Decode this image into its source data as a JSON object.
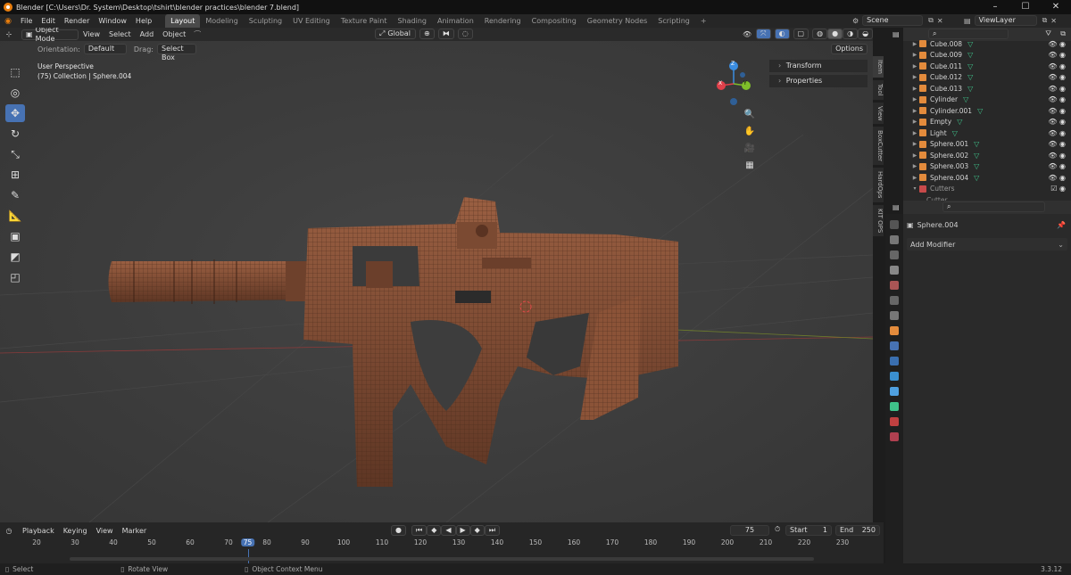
{
  "window": {
    "title": "Blender [C:\\Users\\Dr. System\\Desktop\\tshirt\\blender practices\\blender 7.blend]"
  },
  "menu": {
    "items": [
      "File",
      "Edit",
      "Render",
      "Window",
      "Help"
    ],
    "workspaces": [
      "Layout",
      "Modeling",
      "Sculpting",
      "UV Editing",
      "Texture Paint",
      "Shading",
      "Animation",
      "Rendering",
      "Compositing",
      "Geometry Nodes",
      "Scripting"
    ],
    "active_workspace": "Layout",
    "add_tab": "+",
    "scene": "Scene",
    "view_layer": "ViewLayer"
  },
  "viewport": {
    "mode": "Object Mode",
    "header_menus": [
      "View",
      "Select",
      "Add",
      "Object"
    ],
    "transform_orientation": "Global",
    "orientation_label": "Orientation:",
    "orientation_value": "Default",
    "drag_label": "Drag:",
    "drag_value": "Select Box",
    "options_label": "Options",
    "perspective": "User Perspective",
    "collection_info": "(75) Collection | Sphere.004",
    "npanel": [
      "Transform",
      "Properties"
    ],
    "sidebar_tabs": [
      "Item",
      "Tool",
      "View",
      "BoxCutter",
      "HardOps",
      "KIT OPS"
    ],
    "gizmo": {
      "x": "X",
      "y": "Y",
      "z": "Z"
    }
  },
  "outliner": {
    "items": [
      {
        "name": "Cube.008",
        "mods": 2
      },
      {
        "name": "Cube.009",
        "mods": 1
      },
      {
        "name": "Cube.011",
        "mods": 2
      },
      {
        "name": "Cube.012",
        "mods": 2
      },
      {
        "name": "Cube.013",
        "mods": 1
      },
      {
        "name": "Cylinder",
        "mods": 2
      },
      {
        "name": "Cylinder.001",
        "mods": 2
      },
      {
        "name": "Empty",
        "mods": 1
      },
      {
        "name": "Light",
        "mods": 1
      },
      {
        "name": "Sphere.001",
        "mods": 2
      },
      {
        "name": "Sphere.002",
        "mods": 1
      },
      {
        "name": "Sphere.003",
        "mods": 1
      },
      {
        "name": "Sphere.004",
        "mods": 1
      }
    ],
    "collection": "Cutters",
    "partial_item": "Cutter"
  },
  "properties": {
    "object_name": "Sphere.004",
    "add_modifier": "Add Modifier"
  },
  "timeline": {
    "menus": [
      "Playback",
      "Keying",
      "View",
      "Marker"
    ],
    "current_frame": "75",
    "start_label": "Start",
    "start_value": "1",
    "end_label": "End",
    "end_value": "250",
    "ticks": [
      "20",
      "30",
      "40",
      "50",
      "60",
      "70",
      "75",
      "80",
      "90",
      "100",
      "110",
      "120",
      "130",
      "140",
      "150",
      "160",
      "170",
      "180",
      "190",
      "200",
      "210",
      "220",
      "230"
    ]
  },
  "status": {
    "select": "Select",
    "rotate": "Rotate View",
    "context": "Object Context Menu",
    "version": "3.3.12"
  },
  "colors": {
    "accent_blue": "#4772b3",
    "timeline_marker": "#4772b3",
    "gun_color": "#7a4a32",
    "axis_x": "#e0404a",
    "axis_y": "#7fbf2a",
    "axis_z": "#3b8de0"
  }
}
